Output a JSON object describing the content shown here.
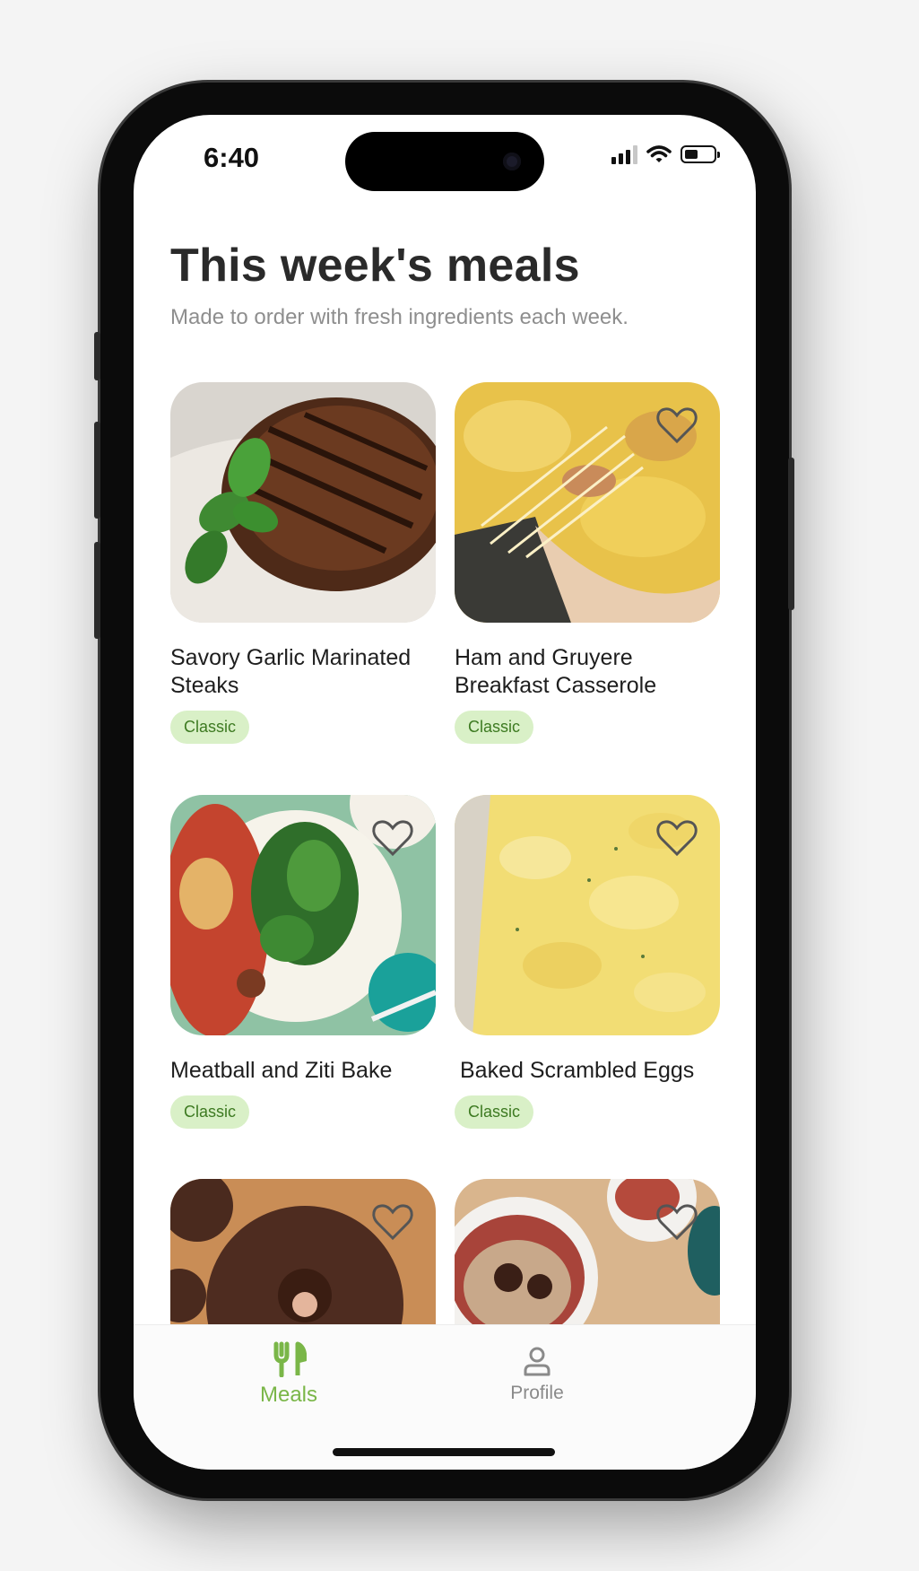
{
  "status_bar": {
    "time": "6:40"
  },
  "header": {
    "title": "This week's meals",
    "subtitle": "Made to order with fresh ingredients each week."
  },
  "meals": [
    {
      "name": "Savory Garlic Marinated Steaks",
      "badge": "Classic"
    },
    {
      "name": "Ham and Gruyere Breakfast Casserole",
      "badge": "Classic"
    },
    {
      "name": "Meatball and Ziti Bake",
      "badge": "Classic"
    },
    {
      "name": "Baked Scrambled Eggs",
      "badge": "Classic"
    }
  ],
  "tabbar": {
    "items": [
      {
        "label": "Meals",
        "icon": "fork-knife-icon",
        "active": true
      },
      {
        "label": "Profile",
        "icon": "person-icon",
        "active": false
      }
    ]
  },
  "colors": {
    "accent": "#7ab648",
    "badge_bg": "#d9f0c7",
    "badge_text": "#3d7a21",
    "title_text": "#2a2a2a",
    "subtitle_text": "#8e8e8e",
    "inactive_tab": "#8a8a8a"
  }
}
